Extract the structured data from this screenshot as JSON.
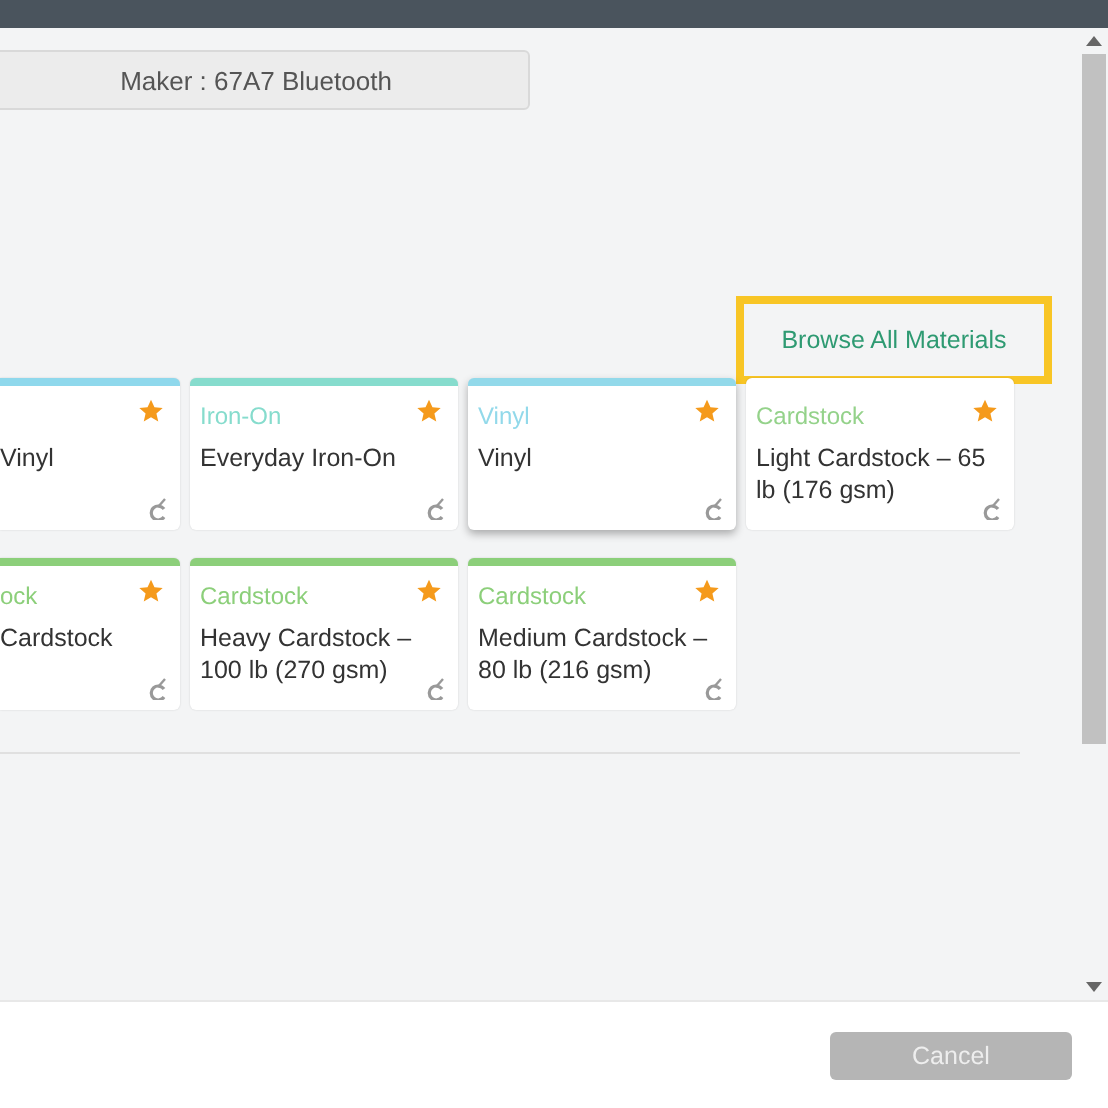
{
  "device_button": {
    "label": "Maker : 67A7 Bluetooth"
  },
  "browse_link": {
    "label": "Browse All Materials",
    "highlighted": true
  },
  "materials": [
    {
      "kind": "partial",
      "name": "Vinyl",
      "color": "#8fd8ec",
      "bar": true,
      "favorite": true,
      "selected": false
    },
    {
      "category": "Iron-On",
      "name": "Everyday Iron-On",
      "color": "#86dccd",
      "bar": true,
      "favorite": true,
      "selected": false
    },
    {
      "category": "Vinyl",
      "name": "Vinyl",
      "color": "#92d9ea",
      "bar": true,
      "favorite": true,
      "selected": true
    },
    {
      "category": "Cardstock",
      "name": "Light Cardstock – 65 lb (176 gsm)",
      "color": "#94d28a",
      "bar": false,
      "favorite": true,
      "selected": false
    },
    {
      "kind": "partial",
      "category": "ock",
      "name": "Cardstock",
      "color": "#8ccf7a",
      "bar": true,
      "favorite": true,
      "selected": false
    },
    {
      "category": "Cardstock",
      "name": "Heavy Cardstock – 100 lb (270 gsm)",
      "color": "#8ccf7a",
      "bar": true,
      "favorite": true,
      "selected": false
    },
    {
      "category": "Cardstock",
      "name": "Medium Cardstock – 80 lb (216 gsm)",
      "color": "#8ccf7a",
      "bar": true,
      "favorite": true,
      "selected": false
    }
  ],
  "footer": {
    "cancel": {
      "label": "Cancel",
      "disabled": true
    }
  }
}
